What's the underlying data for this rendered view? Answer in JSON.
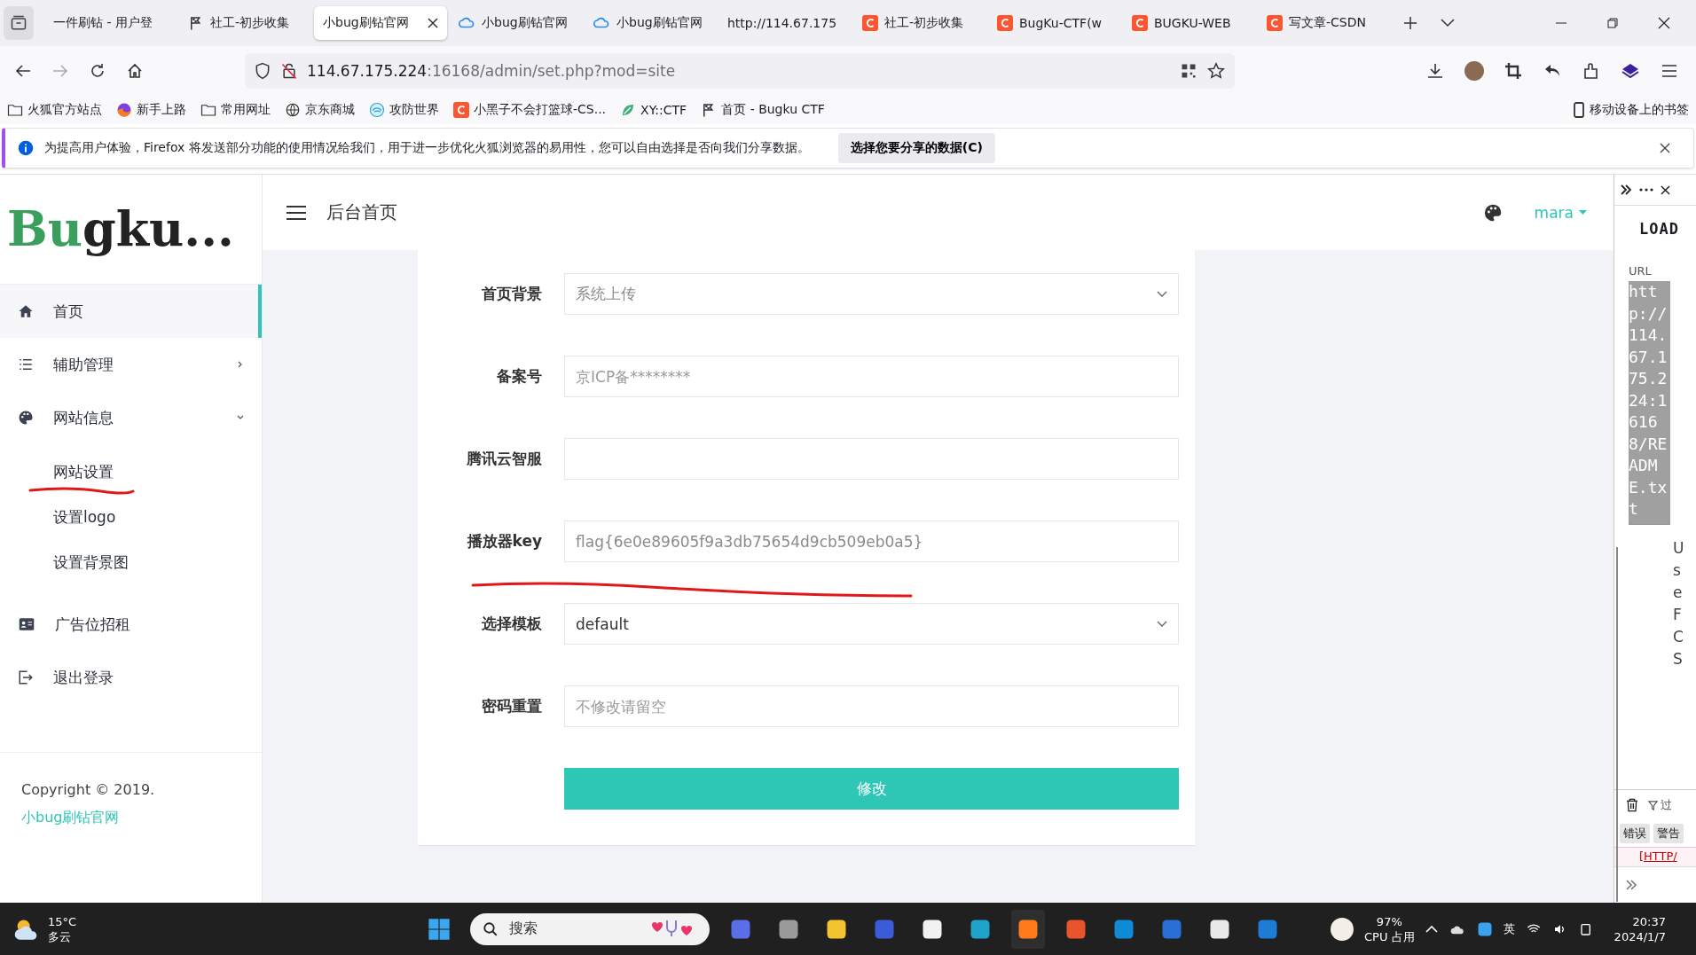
{
  "browser": {
    "tabs": [
      {
        "title": "一件刷钻 - 用户登",
        "kind": "plain",
        "selected": false
      },
      {
        "title": "社工-初步收集",
        "kind": "flag",
        "selected": false
      },
      {
        "title": "小bug刷钻官网",
        "kind": "plain",
        "selected": true
      },
      {
        "title": "小bug刷钻官网",
        "kind": "cloud",
        "selected": false
      },
      {
        "title": "小bug刷钻官网",
        "kind": "cloud",
        "selected": false
      },
      {
        "title": "http://114.67.175",
        "kind": "plain",
        "selected": false
      },
      {
        "title": "社工-初步收集",
        "kind": "c",
        "selected": false
      },
      {
        "title": "BugKu-CTF(w",
        "kind": "c",
        "selected": false
      },
      {
        "title": "BUGKU-WEB",
        "kind": "c",
        "selected": false
      },
      {
        "title": "写文章-CSDN",
        "kind": "c",
        "selected": false
      }
    ],
    "address": {
      "host": "114.67.175.224",
      "path": ":16168/admin/set.php?mod=site"
    },
    "bookmarks": [
      {
        "label": "火狐官方站点",
        "kind": "folder"
      },
      {
        "label": "新手上路",
        "kind": "fox"
      },
      {
        "label": "常用网址",
        "kind": "folder"
      },
      {
        "label": "京东商城",
        "kind": "globe"
      },
      {
        "label": "攻防世界",
        "kind": "swirl"
      },
      {
        "label": "小黑子不会打篮球-CS...",
        "kind": "c"
      },
      {
        "label": "XY::CTF",
        "kind": "leaf"
      },
      {
        "label": "首页 - Bugku CTF",
        "kind": "flag"
      }
    ],
    "mobile_bookmarks": "移动设备上的书签",
    "notice": {
      "text": "为提高用户体验，Firefox 将发送部分功能的使用情况给我们，用于进一步优化火狐浏览器的易用性，您可以自由选择是否向我们分享数据。",
      "button": "选择您要分享的数据(C)"
    }
  },
  "sidebar": {
    "logo": [
      "Bu",
      "gku",
      "..."
    ],
    "items": [
      {
        "label": "首页",
        "kind": "home",
        "selected": true
      },
      {
        "label": "辅助管理",
        "kind": "list",
        "selected": false,
        "expanded": false
      },
      {
        "label": "网站信息",
        "kind": "palette",
        "selected": false,
        "expanded": true,
        "children": [
          {
            "label": "网站设置"
          },
          {
            "label": "设置logo"
          },
          {
            "label": "设置背景图"
          }
        ]
      },
      {
        "label": "广告位招租",
        "kind": "card",
        "selected": false
      },
      {
        "label": "退出登录",
        "kind": "exit",
        "selected": false
      }
    ],
    "footer": {
      "text": "Copyright © 2019. ",
      "link": "小bug刷钻官网"
    }
  },
  "header": {
    "title": "后台首页",
    "user": "mara"
  },
  "form": {
    "fields": [
      {
        "label": "首页背景",
        "kind": "select",
        "value": "系统上传",
        "muted": true
      },
      {
        "label": "备案号",
        "kind": "input",
        "placeholder": "京ICP备********"
      },
      {
        "label": "腾讯云智服",
        "kind": "input"
      },
      {
        "label": "播放器key",
        "kind": "input",
        "value": "flag{6e0e89605f9a3db75654d9cb509eb0a5}",
        "muted": true
      },
      {
        "label": "选择模板",
        "kind": "select",
        "value": "default",
        "muted": false
      },
      {
        "label": "密码重置",
        "kind": "input",
        "placeholder": "不修改请留空"
      }
    ],
    "submit": "修改"
  },
  "devtools": {
    "heading": "LOAD",
    "url_label": "URL",
    "url": "http://114.67.175.224:16168/README.txt",
    "cut_lines": [
      "U",
      "s",
      "e",
      "F",
      "C",
      "S"
    ],
    "filter": "过",
    "tabs": [
      "错误",
      "警告"
    ],
    "error": "[HTTP/"
  },
  "taskbar": {
    "temperature": "15°C",
    "weather": "多云",
    "search": "搜索",
    "cpu": "97%",
    "cpu_label": "CPU 占用",
    "ime": "英",
    "time": "20:37",
    "date": "2024/1/7"
  }
}
